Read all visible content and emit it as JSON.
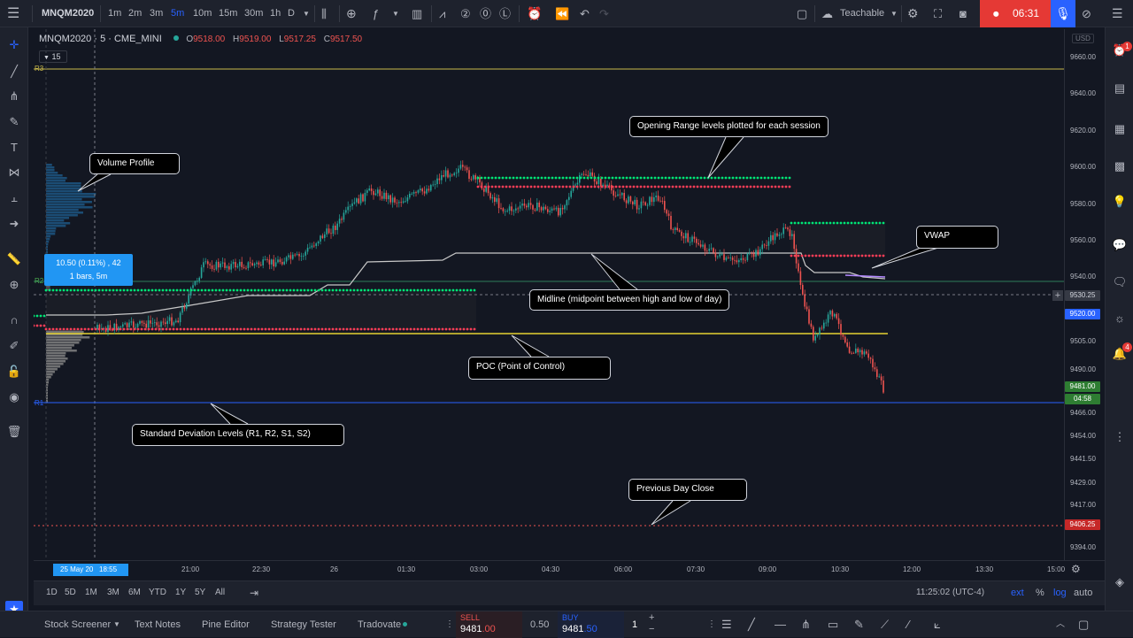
{
  "topbar": {
    "symbol": "MNQM2020",
    "intervals": [
      "1m",
      "2m",
      "3m",
      "5m",
      "10m",
      "15m",
      "30m",
      "1h",
      "D"
    ],
    "active_interval": "5m",
    "layout_name": "Teachable",
    "timer": "06:31",
    "accent": "#2962ff",
    "record_color": "#e53935"
  },
  "legend": {
    "title": "MNQM2020 · 5 · CME_MINI",
    "open_label": "O",
    "open": "9518.00",
    "high_label": "H",
    "high": "9519.00",
    "low_label": "L",
    "low": "9517.25",
    "close_label": "C",
    "close": "9517.50",
    "indicator_badge": "15"
  },
  "measure": {
    "line1": "10.50 (0.11%) , 42",
    "line2": "1 bars, 5m"
  },
  "callouts": {
    "opening_range": "Opening Range levels plotted for each session",
    "volume_profile": "Volume Profile",
    "vwap": "VWAP",
    "midline": "Midline (midpoint between high and low of day)",
    "poc": "POC (Point of Control)",
    "std_dev": "Standard Deviation Levels (R1, R2, S1, S2)",
    "prev_close": "Previous Day Close"
  },
  "level_labels": {
    "r3": "R3",
    "r2": "R2",
    "r1": "R1"
  },
  "price_axis": {
    "currency": "USD",
    "ticks": [
      "9660.00",
      "9640.00",
      "9620.00",
      "9600.00",
      "9580.00",
      "9560.00",
      "9540.00",
      "9505.00",
      "9490.00",
      "9466.00",
      "9454.00",
      "9441.50",
      "9429.00",
      "9417.00",
      "9394.00"
    ],
    "crosshair_price": "9530.25",
    "vwap_price": "9520.00",
    "last_price": "9481.00",
    "countdown": "04:58",
    "prev_close_price": "9406.25"
  },
  "time_axis": {
    "cursor_label": "25 May 20   18:55",
    "ticks": [
      "21:00",
      "22:30",
      "26",
      "01:30",
      "03:00",
      "04:30",
      "06:00",
      "07:30",
      "09:00",
      "10:30",
      "12:00",
      "13:30",
      "15:00"
    ]
  },
  "range_bar": {
    "ranges": [
      "1D",
      "5D",
      "1M",
      "3M",
      "6M",
      "YTD",
      "1Y",
      "5Y",
      "All"
    ],
    "clock": "11:25:02 (UTC-4)",
    "options": [
      "ext",
      "%",
      "log",
      "auto"
    ]
  },
  "footer": {
    "tabs": [
      "Stock Screener",
      "Text Notes",
      "Pine Editor",
      "Strategy Tester",
      "Tradovate"
    ],
    "sell_label": "SELL",
    "sell_price_main": "9481",
    "sell_price_dec": ".00",
    "spread": "0.50",
    "buy_label": "BUY",
    "buy_price_main": "9481",
    "buy_price_dec": ".50",
    "quantity": "1"
  },
  "colors": {
    "bg": "#131722",
    "panel": "#1e222d",
    "up": "#26a69a",
    "down": "#ef5350",
    "green_dots": "#00e676",
    "red_dots": "#ff3d57",
    "poc": "#e6d232",
    "r3": "#c8b84a",
    "r1": "#2962ff",
    "vwap_label": "#2962ff",
    "last_price": "#2e7d32"
  }
}
